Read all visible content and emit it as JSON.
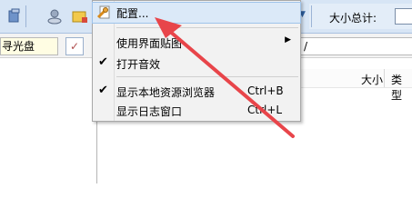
{
  "toolbar": {
    "total_size_label": "大小总计:"
  },
  "address_bar": {
    "drive_label": "寻光盘",
    "path_value": "/"
  },
  "columns": {
    "size": "大小",
    "type": "类型"
  },
  "menu": {
    "items": [
      {
        "label": "配置...",
        "shortcut": "",
        "checked": false,
        "submenu": false,
        "highlighted": true
      },
      {
        "label": "使用界面贴图",
        "shortcut": "",
        "checked": false,
        "submenu": true
      },
      {
        "label": "打开音效",
        "shortcut": "",
        "checked": true,
        "submenu": false
      },
      {
        "label": "显示本地资源浏览器",
        "shortcut": "Ctrl+B",
        "checked": true,
        "submenu": false
      },
      {
        "label": "显示日志窗口",
        "shortcut": "Ctrl+L",
        "checked": false,
        "submenu": false
      }
    ]
  },
  "glyphs": {
    "check": "✔",
    "submenu_arrow": "▶",
    "config_icon": "wrench-page-icon"
  },
  "colors": {
    "annotation": "#e8454a",
    "toolbar": "#d7e5f5",
    "menu_highlight": "#dbe9f8"
  }
}
